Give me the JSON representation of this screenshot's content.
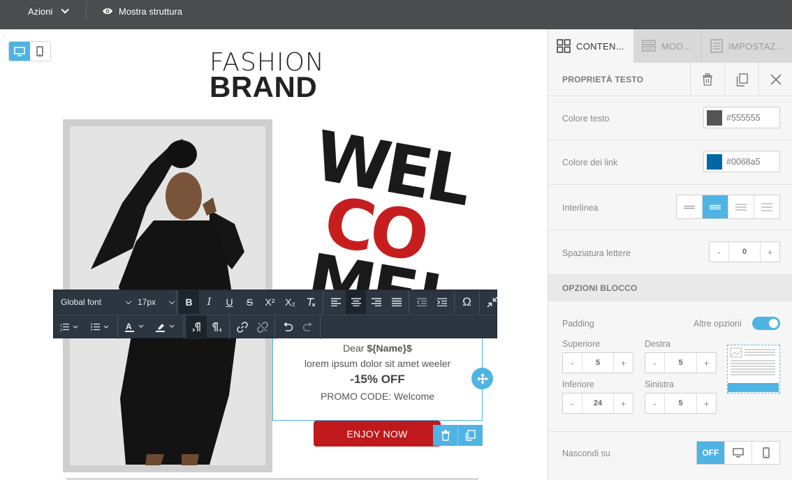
{
  "topbar": {
    "actions_label": "Azioni",
    "structure_label": "Mostra struttura"
  },
  "device_switch": {
    "active": "desktop"
  },
  "email": {
    "brand_line1": "FASHION",
    "brand_line2": "BRAND",
    "welcome_lines": [
      "WEL",
      "CO",
      "ME!"
    ],
    "text_block": {
      "line1_prefix": "Dear ",
      "line1_var": "${Name}$",
      "line2": "lorem ipsum dolor sit amet weeler",
      "line3": "-15% OFF",
      "line4": "PROMO CODE: Welcome"
    },
    "cta_label": "ENJOY NOW",
    "colors": {
      "cta": "#c0191b",
      "accent": "#4fb3e3"
    }
  },
  "toolbar": {
    "font_family": "Global font",
    "font_size": "17px",
    "buttons_row1": [
      "bold",
      "italic",
      "underline",
      "strikethrough",
      "superscript",
      "subscript",
      "clear-format",
      "align-left",
      "align-center",
      "align-right",
      "align-justify",
      "outdent",
      "indent",
      "special-char",
      "collapse"
    ],
    "buttons_row2": [
      "ordered-list",
      "unordered-list",
      "text-color",
      "highlight",
      "ltr",
      "rtl",
      "link",
      "unlink",
      "undo",
      "redo"
    ],
    "labels": {
      "bold": "B",
      "italic": "I",
      "underline": "U",
      "strike": "S",
      "sup": "X²",
      "sub": "X₂",
      "omega": "Ω"
    }
  },
  "panel": {
    "tabs": [
      {
        "label": "CONTEN...",
        "active": true,
        "icon": "grid-icon"
      },
      {
        "label": "MOD...",
        "active": false,
        "icon": "layout-icon"
      },
      {
        "label": "IMPOSTAZ...",
        "active": false,
        "icon": "settings-doc-icon"
      }
    ],
    "text_props_title": "PROPRIETÀ TESTO",
    "text_color_label": "Colore testo",
    "text_color_value": "#555555",
    "link_color_label": "Colore dei link",
    "link_color_value": "#0068a5",
    "line_height_label": "Interlinea",
    "line_height_active_index": 1,
    "letter_spacing_label": "Spaziatura lettere",
    "letter_spacing_value": "0",
    "block_options_title": "OPZIONI BLOCCO",
    "padding_label": "Padding",
    "more_options_label": "Altre opzioni",
    "more_options_on": true,
    "padding": {
      "top_label": "Superiore",
      "top_value": "5",
      "right_label": "Destra",
      "right_value": "5",
      "bottom_label": "Inferiore",
      "bottom_value": "24",
      "left_label": "Sinistra",
      "left_value": "5"
    },
    "hide_on_label": "Nascondi su",
    "hide_on_off": "OFF",
    "minus": "-",
    "plus": "+"
  }
}
